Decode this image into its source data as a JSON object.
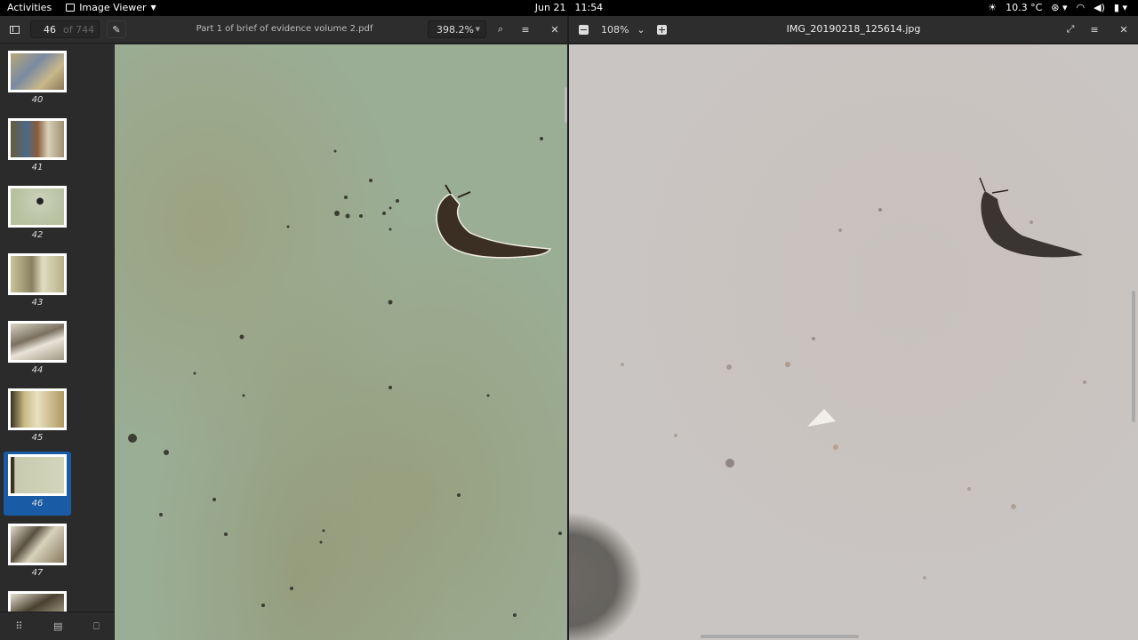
{
  "topbar": {
    "activities": "Activities",
    "app_name": "Image Viewer",
    "date": "Jun 21",
    "time": "11:54",
    "weather": "10.3 °C"
  },
  "pdf_viewer": {
    "page_number": "46",
    "page_total": "of 744",
    "title": "Part 1 of brief of evidence volume 2.pdf",
    "zoom": "398.2%",
    "thumbnails": [
      {
        "label": "40",
        "selected": false
      },
      {
        "label": "41",
        "selected": false
      },
      {
        "label": "42",
        "selected": false
      },
      {
        "label": "43",
        "selected": false
      },
      {
        "label": "44",
        "selected": false
      },
      {
        "label": "45",
        "selected": false
      },
      {
        "label": "46",
        "selected": true
      },
      {
        "label": "47",
        "selected": false
      },
      {
        "label": "",
        "selected": false
      }
    ]
  },
  "image_viewer": {
    "zoom": "108%",
    "title": "IMG_20190218_125614.jpg"
  },
  "colors": {
    "selection": "#1a5ba6",
    "pdf_bg": "#9aae96",
    "photo_bg": "#c9c5c2"
  }
}
